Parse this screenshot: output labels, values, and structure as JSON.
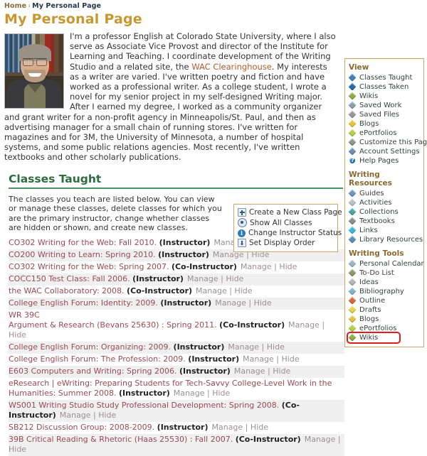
{
  "breadcrumb": {
    "home": "Home",
    "separator": "›",
    "current": "My Personal Page"
  },
  "page_title": "My Personal Page",
  "bio": {
    "paragraph_before_link": "I'm a professor English at Colorado State University, where I also serve as Associate Vice Provost and director of the Institute for Learning and Teaching. I coordinate development of the Writing Studio and a related site, the ",
    "link_text": "WAC Clearinghouse",
    "paragraph_after_link": ". My interests as a writer are varied. I've written poetry and fiction and have worked as a professional writer. As a college student, I wrote a novel for my senior project in my self-designed Writing major. After I earned my degree, I worked as a community organizer and grant writer for a non-profit agency in Minneapolis/St. Paul, and then as advertising manager for a small chain of running stores. I've written for magazines and for 3M, the University of Minnesota, a number of hospital systems, and some public relations agencies. Most recently, I've written textbooks and other scholarly publications."
  },
  "classes_section": {
    "heading": "Classes Taught",
    "intro": "The classes you teach are listed below. You can view or manage these classes, delete classes for which you are the primary instructor, change whether classes are hidden or shown, and create new classes.",
    "actions": [
      {
        "label": "Create a New Class Page",
        "icon": "plus-square-icon"
      },
      {
        "label": "Show All Classes",
        "icon": "radio-icon"
      },
      {
        "label": "Change Instructor Status",
        "icon": "info-icon"
      },
      {
        "label": "Set Display Order",
        "icon": "display-order-icon"
      }
    ],
    "manage_label": "Manage",
    "hide_label": "Hide",
    "separator": "|",
    "rows": [
      {
        "name": "CO302 Writing for the Web: Fall 2010.",
        "role": "(Instructor)",
        "alt": false
      },
      {
        "name": "CO200 Writing to Learn: Spring 2010.",
        "role": "(Instructor)",
        "alt": true
      },
      {
        "name": "CO302 Writing for the Web: Spring 2007.",
        "role": "(Co-Instructor)",
        "alt": false
      },
      {
        "name": "COCC150 Test Class: Fall 2006.",
        "role": "(Instructor)",
        "alt": true
      },
      {
        "name": "the WAC Collaboratory: 2008.",
        "role": "(Co-Instructor)",
        "alt": false
      },
      {
        "name": "College English Forum: Identity: 2009.",
        "role": "(Instructor)",
        "alt": true
      },
      {
        "name": "WR 39C\nArgument & Research (Bevans 25630) : Spring 2011.",
        "role": "(Co-Instructor)",
        "alt": false
      },
      {
        "name": "College English Forum: Organizing: 2009.",
        "role": "(Instructor)",
        "alt": true
      },
      {
        "name": "College English Forum: The Profession: 2009.",
        "role": "(Instructor)",
        "alt": false
      },
      {
        "name": "E603 Computers and Writing: Spring 2006.",
        "role": "(Instructor)",
        "alt": true
      },
      {
        "name": "eResearch | eWriting: Preparing Students for Tech-Savvy College-Level Work in the Humanities: Summer 2008.",
        "role": "(Instructor)",
        "alt": false
      },
      {
        "name": "WS001 Writing Studio Study Professional Development: Spring 2008.",
        "role": "(Co-Instructor)",
        "alt": true
      },
      {
        "name": "SB212 Discussion Group: 2008-2009.",
        "role": "(Instructor)",
        "alt": false
      },
      {
        "name": "39B Critical Reading & Rhetoric (Haas 25530) : Fall 2007.",
        "role": "(Co-Instructor)",
        "alt": true
      }
    ]
  },
  "sidebar": {
    "groups": [
      {
        "title": "View",
        "items": [
          {
            "label": "Classes Taught",
            "icon": "gem-icon",
            "color": "#4a7fb5",
            "highlighted": false
          },
          {
            "label": "Classes Taken",
            "icon": "gem-icon",
            "color": "#2f6aa8",
            "highlighted": false
          },
          {
            "label": "Wikis",
            "icon": "gem-icon",
            "color": "#8fae4a",
            "highlighted": false
          },
          {
            "label": "Saved Work",
            "icon": "gem-icon",
            "color": "#8fa0b5",
            "highlighted": false
          },
          {
            "label": "Saved Files",
            "icon": "gem-icon",
            "color": "#9a9a9a",
            "highlighted": false
          },
          {
            "label": "Blogs",
            "icon": "gem-icon",
            "color": "#e8c43a",
            "highlighted": false
          },
          {
            "label": "ePortfolios",
            "icon": "gem-icon",
            "color": "#b7d14a",
            "highlighted": false
          },
          {
            "label": "Customize this Page",
            "icon": "gem-icon",
            "color": "#8a9a8a",
            "highlighted": false
          },
          {
            "label": "Account Settings",
            "icon": "gem-icon",
            "color": "#6f8fb5",
            "highlighted": false
          },
          {
            "label": "Help Pages",
            "icon": "help-icon",
            "color": "#2b7bc0",
            "highlighted": false
          }
        ]
      },
      {
        "title": "Writing Resources",
        "items": [
          {
            "label": "Guides",
            "icon": "gem-icon",
            "color": "#6f96bc",
            "highlighted": false
          },
          {
            "label": "Activities",
            "icon": "gem-icon",
            "color": "#b9c2cb",
            "highlighted": false
          },
          {
            "label": "Collections",
            "icon": "gem-icon",
            "color": "#4aa8a8",
            "highlighted": false
          },
          {
            "label": "Textbooks",
            "icon": "gem-icon",
            "color": "#8f8f8f",
            "highlighted": false
          },
          {
            "label": "Links",
            "icon": "gem-icon",
            "color": "#3ab8d8",
            "highlighted": false
          },
          {
            "label": "Library Resources",
            "icon": "gem-icon",
            "color": "#5a8fc0",
            "highlighted": false
          }
        ]
      },
      {
        "title": "Writing Tools",
        "items": [
          {
            "label": "Personal Calendar",
            "icon": "gem-icon",
            "color": "#9fb5c5",
            "highlighted": false
          },
          {
            "label": "To-Do List",
            "icon": "gem-icon",
            "color": "#8f9a6a",
            "highlighted": false
          },
          {
            "label": "Ideas",
            "icon": "gem-icon",
            "color": "#b5b5b5",
            "highlighted": false
          },
          {
            "label": "Bibliography",
            "icon": "gem-icon",
            "color": "#7fb5d8",
            "highlighted": false
          },
          {
            "label": "Outline",
            "icon": "gem-icon",
            "color": "#d86a3a",
            "highlighted": false
          },
          {
            "label": "Drafts",
            "icon": "gem-icon",
            "color": "#e8d44a",
            "highlighted": false
          },
          {
            "label": "Blogs",
            "icon": "gem-icon",
            "color": "#e8c43a",
            "highlighted": false
          },
          {
            "label": "ePortfolios",
            "icon": "gem-icon",
            "color": "#b7d14a",
            "highlighted": false
          },
          {
            "label": "Wikis",
            "icon": "gem-icon",
            "color": "#8fae4a",
            "highlighted": true
          }
        ]
      }
    ]
  },
  "colors": {
    "page_title": "#c8982f",
    "section_heading": "#2e6b3e",
    "box_border": "#c9a86a",
    "class_link": "#9a4a52",
    "muted_link": "#9e8e96",
    "bio_link": "#b05a2a",
    "highlight": "#e01b1b"
  }
}
